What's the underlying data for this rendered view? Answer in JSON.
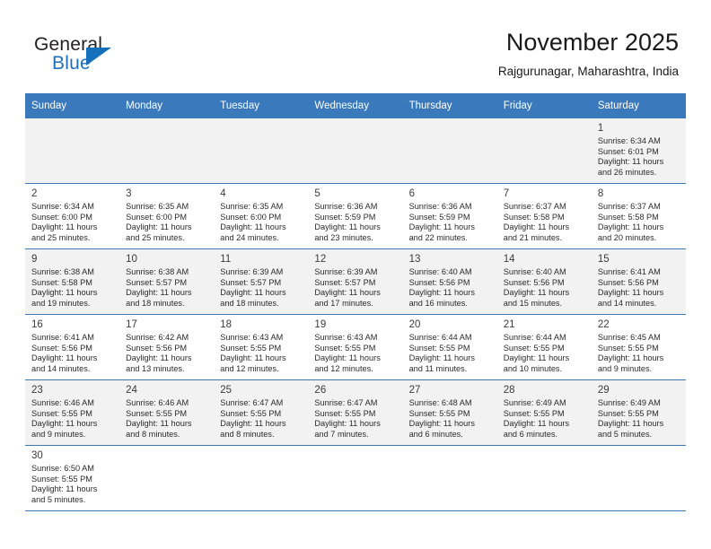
{
  "brand": {
    "name_top": "General",
    "name_bottom": "Blue",
    "accent_color": "#1570bc",
    "triangle_icon": "brand-triangle-icon"
  },
  "header": {
    "title": "November 2025",
    "subtitle": "Rajgurunagar, Maharashtra, India"
  },
  "theme": {
    "header_row_bg": "#3a79bc",
    "header_row_text": "#ffffff",
    "shaded_row_bg": "#f2f2f2",
    "row_border": "#3a79bc"
  },
  "calendar": {
    "weekday_headers": [
      "Sunday",
      "Monday",
      "Tuesday",
      "Wednesday",
      "Thursday",
      "Friday",
      "Saturday"
    ],
    "labels": {
      "sunrise": "Sunrise:",
      "sunset": "Sunset:",
      "daylight": "Daylight:"
    },
    "weeks": [
      {
        "shaded": true,
        "days": [
          {
            "day": "",
            "sunrise": "",
            "sunset": "",
            "daylight_line1": "",
            "daylight_line2": ""
          },
          {
            "day": "",
            "sunrise": "",
            "sunset": "",
            "daylight_line1": "",
            "daylight_line2": ""
          },
          {
            "day": "",
            "sunrise": "",
            "sunset": "",
            "daylight_line1": "",
            "daylight_line2": ""
          },
          {
            "day": "",
            "sunrise": "",
            "sunset": "",
            "daylight_line1": "",
            "daylight_line2": ""
          },
          {
            "day": "",
            "sunrise": "",
            "sunset": "",
            "daylight_line1": "",
            "daylight_line2": ""
          },
          {
            "day": "",
            "sunrise": "",
            "sunset": "",
            "daylight_line1": "",
            "daylight_line2": ""
          },
          {
            "day": "1",
            "sunrise": "Sunrise: 6:34 AM",
            "sunset": "Sunset: 6:01 PM",
            "daylight_line1": "Daylight: 11 hours",
            "daylight_line2": "and 26 minutes."
          }
        ]
      },
      {
        "shaded": false,
        "days": [
          {
            "day": "2",
            "sunrise": "Sunrise: 6:34 AM",
            "sunset": "Sunset: 6:00 PM",
            "daylight_line1": "Daylight: 11 hours",
            "daylight_line2": "and 25 minutes."
          },
          {
            "day": "3",
            "sunrise": "Sunrise: 6:35 AM",
            "sunset": "Sunset: 6:00 PM",
            "daylight_line1": "Daylight: 11 hours",
            "daylight_line2": "and 25 minutes."
          },
          {
            "day": "4",
            "sunrise": "Sunrise: 6:35 AM",
            "sunset": "Sunset: 6:00 PM",
            "daylight_line1": "Daylight: 11 hours",
            "daylight_line2": "and 24 minutes."
          },
          {
            "day": "5",
            "sunrise": "Sunrise: 6:36 AM",
            "sunset": "Sunset: 5:59 PM",
            "daylight_line1": "Daylight: 11 hours",
            "daylight_line2": "and 23 minutes."
          },
          {
            "day": "6",
            "sunrise": "Sunrise: 6:36 AM",
            "sunset": "Sunset: 5:59 PM",
            "daylight_line1": "Daylight: 11 hours",
            "daylight_line2": "and 22 minutes."
          },
          {
            "day": "7",
            "sunrise": "Sunrise: 6:37 AM",
            "sunset": "Sunset: 5:58 PM",
            "daylight_line1": "Daylight: 11 hours",
            "daylight_line2": "and 21 minutes."
          },
          {
            "day": "8",
            "sunrise": "Sunrise: 6:37 AM",
            "sunset": "Sunset: 5:58 PM",
            "daylight_line1": "Daylight: 11 hours",
            "daylight_line2": "and 20 minutes."
          }
        ]
      },
      {
        "shaded": true,
        "days": [
          {
            "day": "9",
            "sunrise": "Sunrise: 6:38 AM",
            "sunset": "Sunset: 5:58 PM",
            "daylight_line1": "Daylight: 11 hours",
            "daylight_line2": "and 19 minutes."
          },
          {
            "day": "10",
            "sunrise": "Sunrise: 6:38 AM",
            "sunset": "Sunset: 5:57 PM",
            "daylight_line1": "Daylight: 11 hours",
            "daylight_line2": "and 18 minutes."
          },
          {
            "day": "11",
            "sunrise": "Sunrise: 6:39 AM",
            "sunset": "Sunset: 5:57 PM",
            "daylight_line1": "Daylight: 11 hours",
            "daylight_line2": "and 18 minutes."
          },
          {
            "day": "12",
            "sunrise": "Sunrise: 6:39 AM",
            "sunset": "Sunset: 5:57 PM",
            "daylight_line1": "Daylight: 11 hours",
            "daylight_line2": "and 17 minutes."
          },
          {
            "day": "13",
            "sunrise": "Sunrise: 6:40 AM",
            "sunset": "Sunset: 5:56 PM",
            "daylight_line1": "Daylight: 11 hours",
            "daylight_line2": "and 16 minutes."
          },
          {
            "day": "14",
            "sunrise": "Sunrise: 6:40 AM",
            "sunset": "Sunset: 5:56 PM",
            "daylight_line1": "Daylight: 11 hours",
            "daylight_line2": "and 15 minutes."
          },
          {
            "day": "15",
            "sunrise": "Sunrise: 6:41 AM",
            "sunset": "Sunset: 5:56 PM",
            "daylight_line1": "Daylight: 11 hours",
            "daylight_line2": "and 14 minutes."
          }
        ]
      },
      {
        "shaded": false,
        "days": [
          {
            "day": "16",
            "sunrise": "Sunrise: 6:41 AM",
            "sunset": "Sunset: 5:56 PM",
            "daylight_line1": "Daylight: 11 hours",
            "daylight_line2": "and 14 minutes."
          },
          {
            "day": "17",
            "sunrise": "Sunrise: 6:42 AM",
            "sunset": "Sunset: 5:56 PM",
            "daylight_line1": "Daylight: 11 hours",
            "daylight_line2": "and 13 minutes."
          },
          {
            "day": "18",
            "sunrise": "Sunrise: 6:43 AM",
            "sunset": "Sunset: 5:55 PM",
            "daylight_line1": "Daylight: 11 hours",
            "daylight_line2": "and 12 minutes."
          },
          {
            "day": "19",
            "sunrise": "Sunrise: 6:43 AM",
            "sunset": "Sunset: 5:55 PM",
            "daylight_line1": "Daylight: 11 hours",
            "daylight_line2": "and 12 minutes."
          },
          {
            "day": "20",
            "sunrise": "Sunrise: 6:44 AM",
            "sunset": "Sunset: 5:55 PM",
            "daylight_line1": "Daylight: 11 hours",
            "daylight_line2": "and 11 minutes."
          },
          {
            "day": "21",
            "sunrise": "Sunrise: 6:44 AM",
            "sunset": "Sunset: 5:55 PM",
            "daylight_line1": "Daylight: 11 hours",
            "daylight_line2": "and 10 minutes."
          },
          {
            "day": "22",
            "sunrise": "Sunrise: 6:45 AM",
            "sunset": "Sunset: 5:55 PM",
            "daylight_line1": "Daylight: 11 hours",
            "daylight_line2": "and 9 minutes."
          }
        ]
      },
      {
        "shaded": true,
        "days": [
          {
            "day": "23",
            "sunrise": "Sunrise: 6:46 AM",
            "sunset": "Sunset: 5:55 PM",
            "daylight_line1": "Daylight: 11 hours",
            "daylight_line2": "and 9 minutes."
          },
          {
            "day": "24",
            "sunrise": "Sunrise: 6:46 AM",
            "sunset": "Sunset: 5:55 PM",
            "daylight_line1": "Daylight: 11 hours",
            "daylight_line2": "and 8 minutes."
          },
          {
            "day": "25",
            "sunrise": "Sunrise: 6:47 AM",
            "sunset": "Sunset: 5:55 PM",
            "daylight_line1": "Daylight: 11 hours",
            "daylight_line2": "and 8 minutes."
          },
          {
            "day": "26",
            "sunrise": "Sunrise: 6:47 AM",
            "sunset": "Sunset: 5:55 PM",
            "daylight_line1": "Daylight: 11 hours",
            "daylight_line2": "and 7 minutes."
          },
          {
            "day": "27",
            "sunrise": "Sunrise: 6:48 AM",
            "sunset": "Sunset: 5:55 PM",
            "daylight_line1": "Daylight: 11 hours",
            "daylight_line2": "and 6 minutes."
          },
          {
            "day": "28",
            "sunrise": "Sunrise: 6:49 AM",
            "sunset": "Sunset: 5:55 PM",
            "daylight_line1": "Daylight: 11 hours",
            "daylight_line2": "and 6 minutes."
          },
          {
            "day": "29",
            "sunrise": "Sunrise: 6:49 AM",
            "sunset": "Sunset: 5:55 PM",
            "daylight_line1": "Daylight: 11 hours",
            "daylight_line2": "and 5 minutes."
          }
        ]
      },
      {
        "shaded": false,
        "days": [
          {
            "day": "30",
            "sunrise": "Sunrise: 6:50 AM",
            "sunset": "Sunset: 5:55 PM",
            "daylight_line1": "Daylight: 11 hours",
            "daylight_line2": "and 5 minutes."
          },
          {
            "day": "",
            "sunrise": "",
            "sunset": "",
            "daylight_line1": "",
            "daylight_line2": ""
          },
          {
            "day": "",
            "sunrise": "",
            "sunset": "",
            "daylight_line1": "",
            "daylight_line2": ""
          },
          {
            "day": "",
            "sunrise": "",
            "sunset": "",
            "daylight_line1": "",
            "daylight_line2": ""
          },
          {
            "day": "",
            "sunrise": "",
            "sunset": "",
            "daylight_line1": "",
            "daylight_line2": ""
          },
          {
            "day": "",
            "sunrise": "",
            "sunset": "",
            "daylight_line1": "",
            "daylight_line2": ""
          },
          {
            "day": "",
            "sunrise": "",
            "sunset": "",
            "daylight_line1": "",
            "daylight_line2": ""
          }
        ]
      }
    ]
  }
}
